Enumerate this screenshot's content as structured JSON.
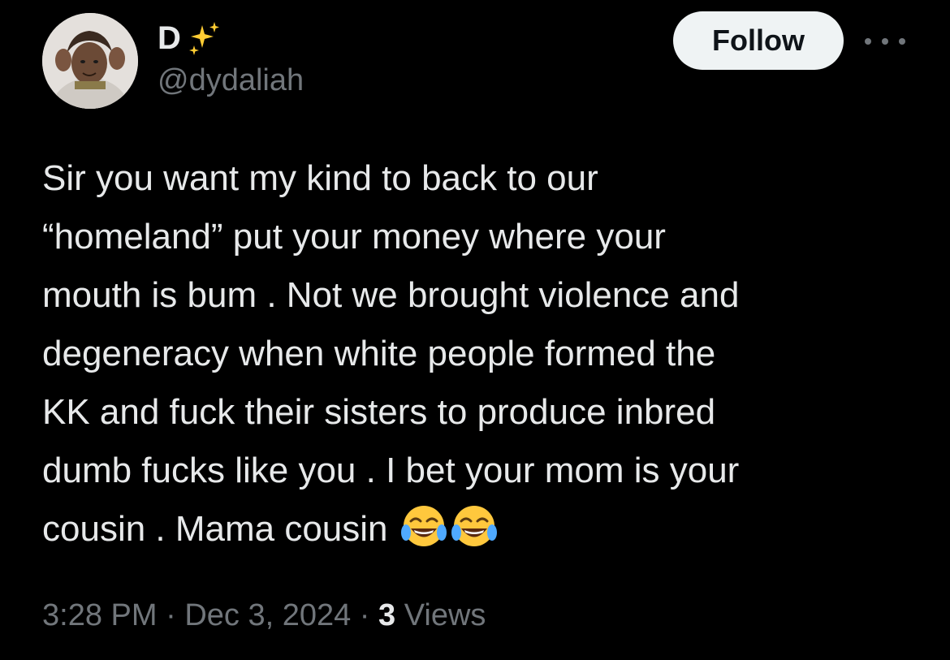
{
  "author": {
    "display_name": "D",
    "name_emoji": "sparkles-icon",
    "handle": "@dydaliah"
  },
  "actions": {
    "follow_label": "Follow",
    "more_icon": "more-horizontal-icon"
  },
  "tweet": {
    "lines": [
      "Sir you want my kind to back to our",
      "“homeland” put your money where your",
      "mouth is bum . Not we brought violence and",
      "degeneracy when white people formed the",
      "KK and fuck their sisters to produce inbred",
      "dumb fucks like you . I bet your mom is your",
      "cousin . Mama cousin"
    ],
    "trailing_emojis": [
      "face-with-tears-of-joy-icon",
      "face-with-tears-of-joy-icon"
    ]
  },
  "meta": {
    "time": "3:28 PM",
    "sep1": " · ",
    "date": "Dec 3, 2024",
    "sep2": " · ",
    "views_count": "3",
    "views_label": " Views"
  },
  "colors": {
    "background": "#000000",
    "text_primary": "#e7e9ea",
    "text_secondary": "#71767b",
    "follow_bg": "#eff3f4",
    "sparkle_yellow": "#ffcc33"
  }
}
